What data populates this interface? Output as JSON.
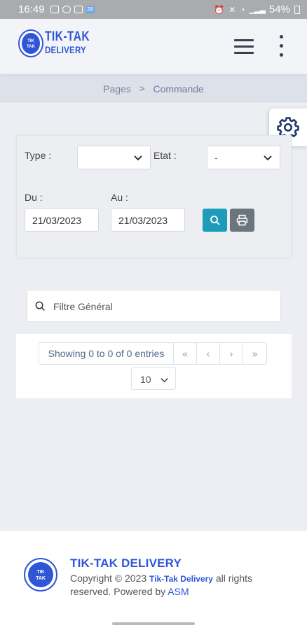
{
  "status_bar": {
    "time": "16:49",
    "battery": "54%"
  },
  "header": {
    "brand_line1": "TIK-TAK",
    "brand_line2": "DELIVERY",
    "logo_text": "TIK-TAK"
  },
  "breadcrumb": {
    "root": "Pages",
    "separator": ">",
    "current": "Commande"
  },
  "filters": {
    "type_label": "Type :",
    "type_value": "",
    "etat_label": "Etat :",
    "etat_value": "-",
    "du_label": "Du :",
    "du_value": "21/03/2023",
    "au_label": "Au :",
    "au_value": "21/03/2023"
  },
  "search": {
    "placeholder": "Filtre Général"
  },
  "table": {
    "info": "Showing 0 to 0 of 0 entries",
    "first": "«",
    "prev": "‹",
    "next": "›",
    "last": "»",
    "page_size": "10"
  },
  "footer": {
    "title": "TIK-TAK DELIVERY",
    "copyright_prefix": "Copyright © 2023 ",
    "company_link": "Tik-Tak Delivery",
    "copyright_mid": " all rights reserved. Powered by ",
    "powered_link": "ASM"
  },
  "colors": {
    "brand": "#2f56d6",
    "search_button": "#1c9cb8",
    "print_button": "#6b757e"
  },
  "icons": [
    "menu-icon",
    "more-vert-icon",
    "gear-icon",
    "chevron-down-icon",
    "search-icon",
    "print-icon"
  ]
}
